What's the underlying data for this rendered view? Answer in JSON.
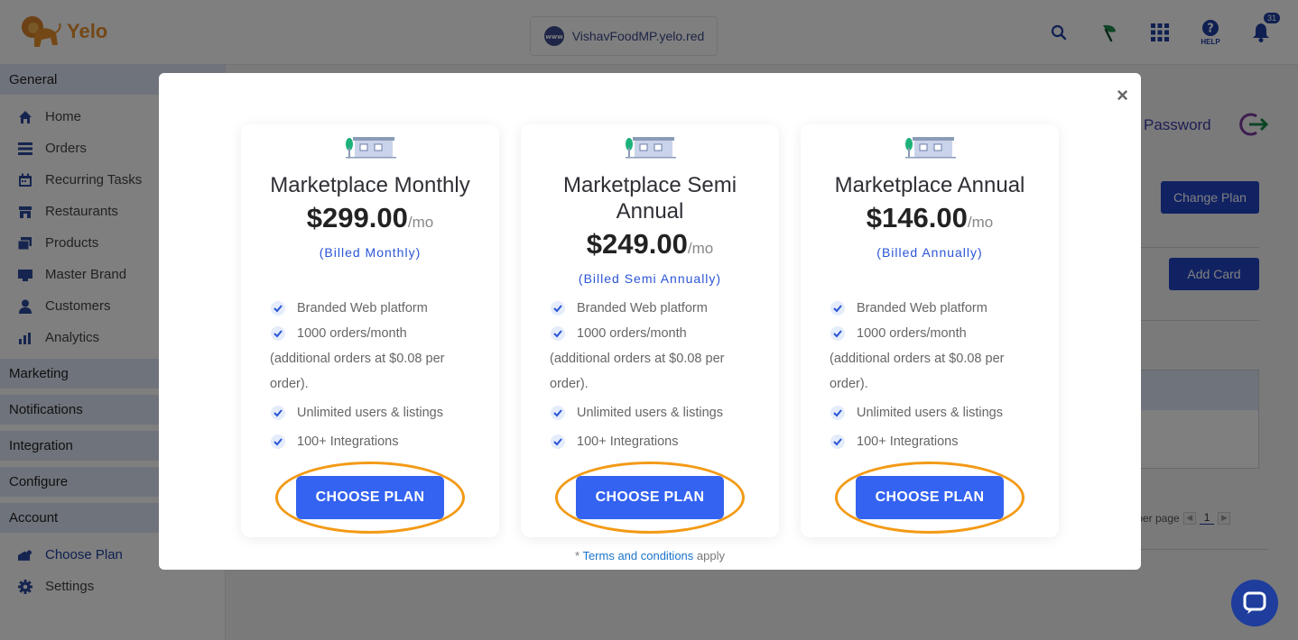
{
  "app": {
    "name": "Yelo",
    "brand_color": "#e8912d",
    "accent": "#2244c7"
  },
  "topbar": {
    "domain": "VishavFoodMP.yelo.red",
    "help_label": "HELP",
    "notification_count": "31",
    "icons": [
      "search-icon",
      "leaf-icon",
      "apps-grid-icon",
      "help-icon",
      "bell-icon"
    ]
  },
  "sidebar": {
    "general": "General",
    "items": [
      {
        "label": "Home",
        "icon": "home-icon"
      },
      {
        "label": "Orders",
        "icon": "list-icon"
      },
      {
        "label": "Recurring Tasks",
        "icon": "calendar-icon"
      },
      {
        "label": "Restaurants",
        "icon": "store-icon"
      },
      {
        "label": "Products",
        "icon": "products-icon"
      },
      {
        "label": "Master Brand",
        "icon": "brand-icon"
      },
      {
        "label": "Customers",
        "icon": "user-icon"
      },
      {
        "label": "Analytics",
        "icon": "chart-icon"
      }
    ],
    "sections": [
      "Marketing",
      "Notifications",
      "Integration",
      "Configure",
      "Account"
    ],
    "account_items": [
      {
        "label": "Choose Plan",
        "icon": "plan-icon"
      },
      {
        "label": "Settings",
        "icon": "gear-icon"
      }
    ]
  },
  "main": {
    "password_link": "Password",
    "change_plan": "Change Plan",
    "add_card": "Add Card",
    "per_page": "s per page",
    "page_num": "1"
  },
  "modal": {
    "plans": [
      {
        "name": "Marketplace Monthly",
        "amount": "$299.00",
        "per": "/mo",
        "billed": "(Billed Monthly)",
        "features": [
          "Branded Web platform",
          "1000 orders/month",
          "(additional orders at $0.08 per order).",
          "Unlimited users & listings",
          "100+ Integrations"
        ],
        "cta": "CHOOSE PLAN"
      },
      {
        "name": "Marketplace Semi Annual",
        "amount": "$249.00",
        "per": "/mo",
        "billed": "(Billed Semi Annually)",
        "features": [
          "Branded Web platform",
          "1000 orders/month",
          "(additional orders at $0.08 per order).",
          "Unlimited users & listings",
          "100+ Integrations"
        ],
        "cta": "CHOOSE PLAN"
      },
      {
        "name": "Marketplace Annual",
        "amount": "$146.00",
        "per": "/mo",
        "billed": "(Billed Annually)",
        "features": [
          "Branded Web platform",
          "1000 orders/month",
          "(additional orders at $0.08 per order).",
          "Unlimited users & listings",
          "100+ Integrations"
        ],
        "cta": "CHOOSE PLAN"
      }
    ],
    "terms_prefix": "* ",
    "terms_link": "Terms and conditions",
    "terms_suffix": " apply",
    "close_symbol": "×"
  }
}
